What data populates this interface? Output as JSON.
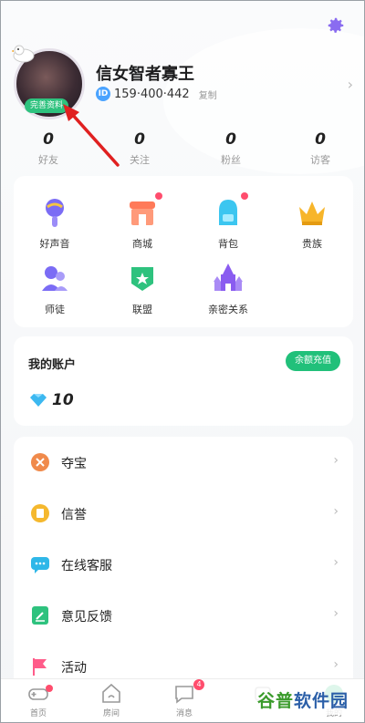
{
  "profile": {
    "avatar_badge": "完善资料",
    "username": "信女智者寡王",
    "id_label": "ID",
    "id_number": "159·400·442",
    "copy_label": "复制"
  },
  "stats": [
    {
      "value": "0",
      "label": "好友"
    },
    {
      "value": "0",
      "label": "关注"
    },
    {
      "value": "0",
      "label": "粉丝"
    },
    {
      "value": "0",
      "label": "访客"
    }
  ],
  "features": [
    {
      "label": "好声音",
      "icon": "microphone-icon"
    },
    {
      "label": "商城",
      "icon": "store-icon",
      "dot": true
    },
    {
      "label": "背包",
      "icon": "backpack-icon",
      "dot": true
    },
    {
      "label": "贵族",
      "icon": "crown-icon"
    },
    {
      "label": "师徒",
      "icon": "mentor-icon"
    },
    {
      "label": "联盟",
      "icon": "shield-icon"
    },
    {
      "label": "亲密关系",
      "icon": "castle-icon"
    }
  ],
  "account": {
    "title": "我的账户",
    "recharge_label": "余额充值",
    "diamond_value": "10"
  },
  "menu": [
    {
      "label": "夺宝",
      "icon": "treasure-icon",
      "color": "#f08a4b"
    },
    {
      "label": "信誉",
      "icon": "credit-icon",
      "color": "#f5b82e"
    },
    {
      "label": "在线客服",
      "icon": "chat-icon",
      "color": "#2fb7e8"
    },
    {
      "label": "意见反馈",
      "icon": "feedback-icon",
      "color": "#2ec27e"
    },
    {
      "label": "活动",
      "icon": "flag-icon",
      "color": "#ff5c8a"
    }
  ],
  "tabs": [
    {
      "label": "首页",
      "icon": "gamepad-icon"
    },
    {
      "label": "房间",
      "icon": "room-icon"
    },
    {
      "label": "消息",
      "icon": "message-icon",
      "badge": "4"
    },
    {
      "label": "",
      "icon": "tab4-icon"
    },
    {
      "label": "我的",
      "icon": "me-icon"
    }
  ],
  "watermark": {
    "part1": "谷普",
    "part2": "软件园"
  },
  "colors": {
    "accent_green": "#21c07a",
    "settings_purple": "#8a6cf0",
    "red_dot": "#ff4d6d"
  }
}
